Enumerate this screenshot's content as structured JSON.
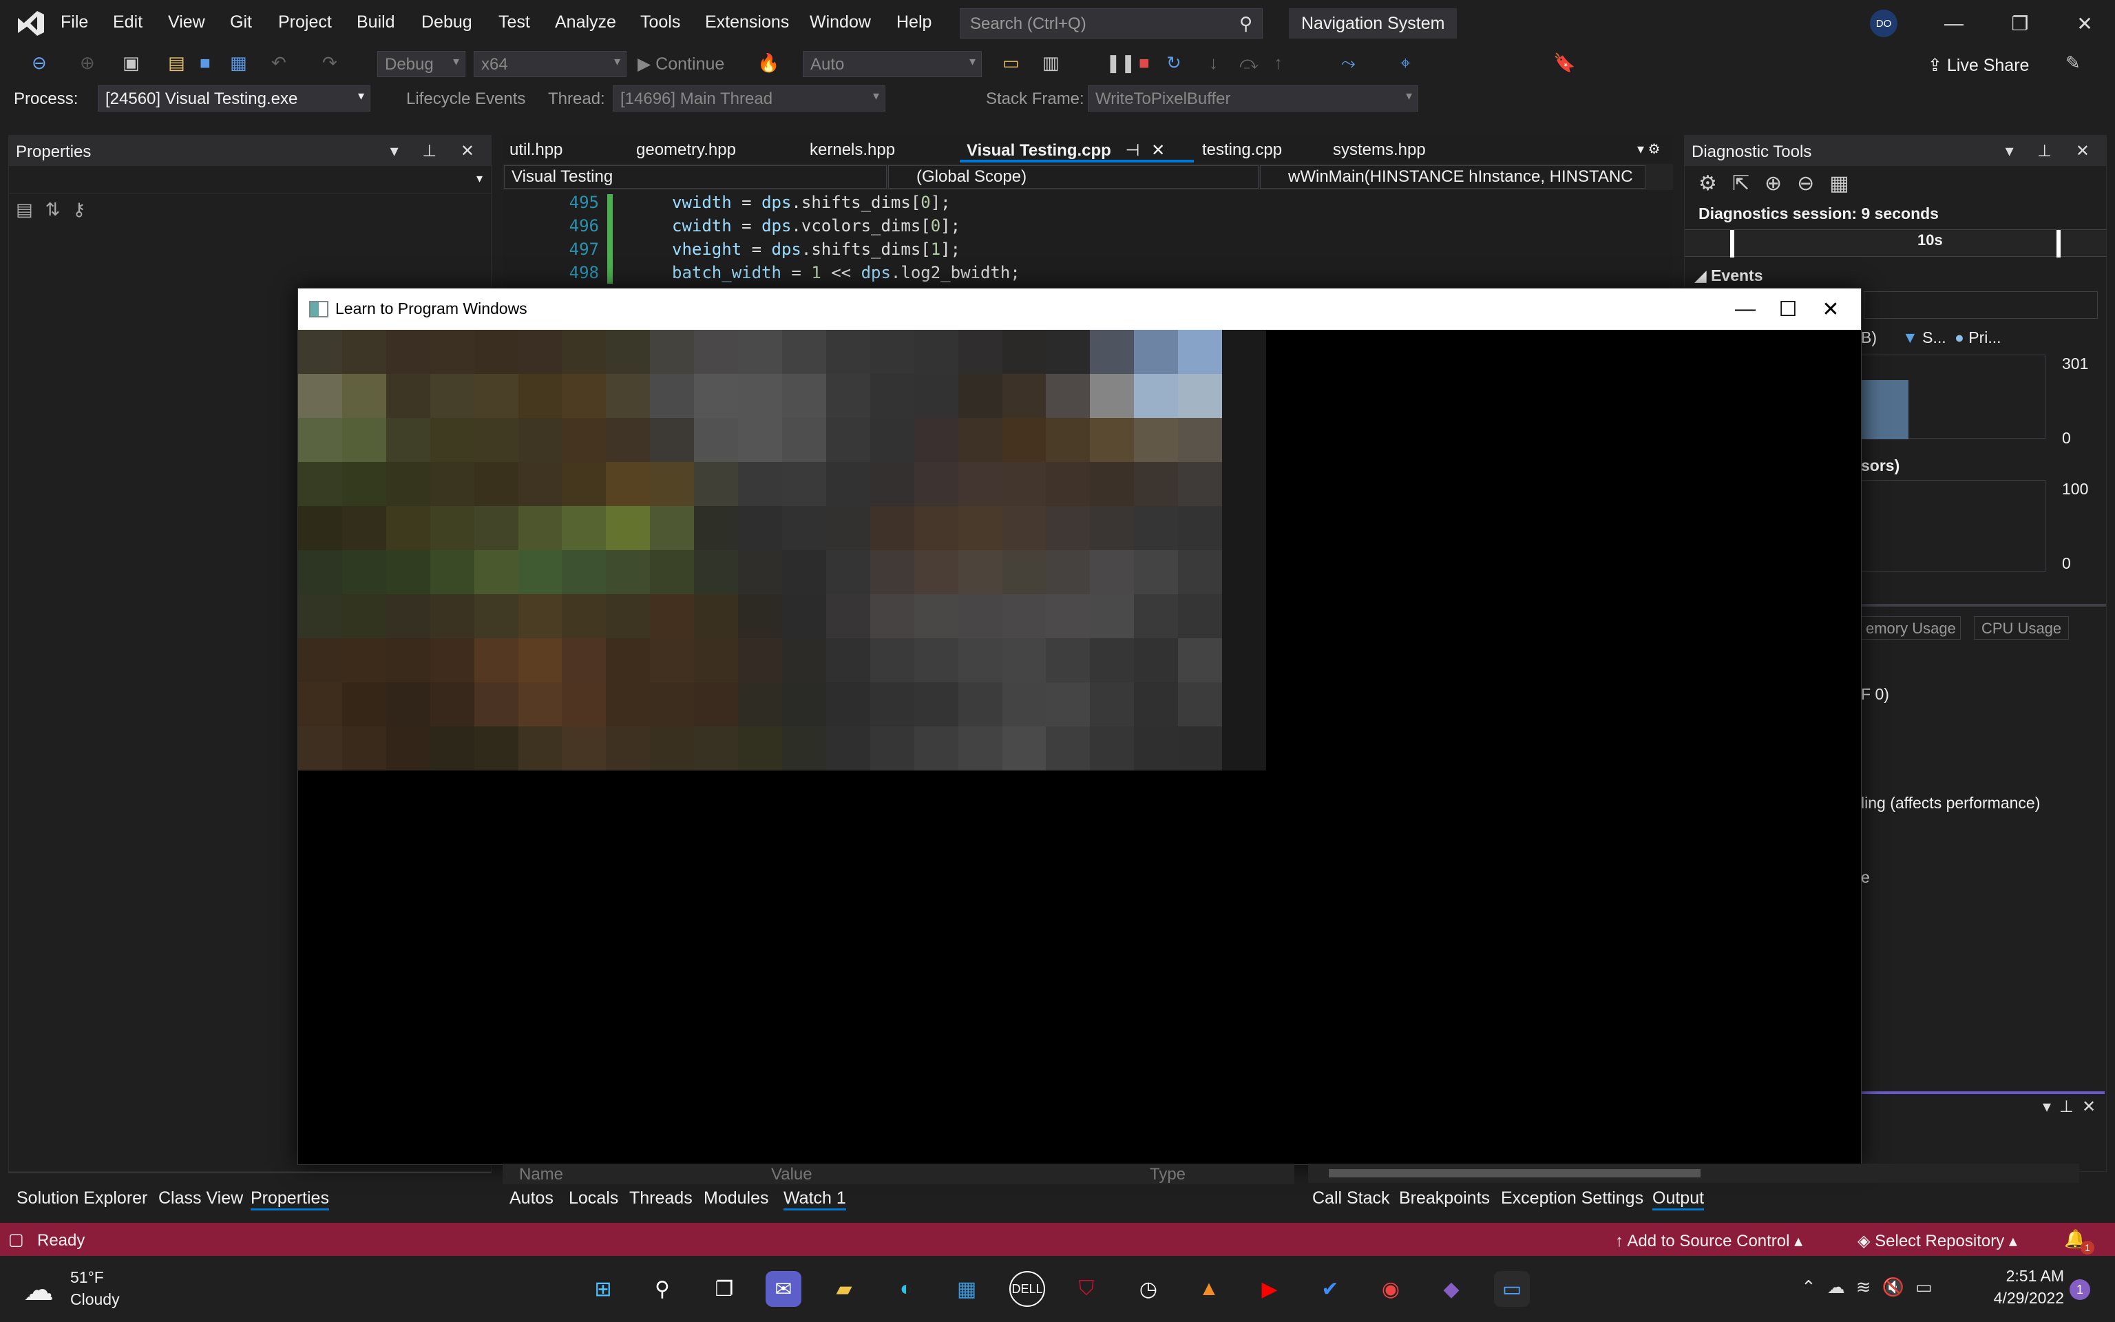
{
  "menu": {
    "items": [
      "File",
      "Edit",
      "View",
      "Git",
      "Project",
      "Build",
      "Debug",
      "Test",
      "Analyze",
      "Tools",
      "Extensions",
      "Window",
      "Help"
    ],
    "search_placeholder": "Search (Ctrl+Q)",
    "solution_name": "Navigation System",
    "avatar_initials": "DO"
  },
  "toolbar": {
    "config": "Debug",
    "platform": "x64",
    "continue_label": "Continue",
    "auto_combo": "Auto",
    "live_share": "Live Share"
  },
  "debugbar": {
    "process_label": "Process:",
    "process_value": "[24560] Visual Testing.exe",
    "lifecycle_label": "Lifecycle Events",
    "thread_label": "Thread:",
    "thread_value": "[14696] Main Thread",
    "stack_label": "Stack Frame:",
    "stack_value": "WriteToPixelBuffer"
  },
  "properties": {
    "title": "Properties"
  },
  "editor": {
    "tabs": [
      "util.hpp",
      "geometry.hpp",
      "kernels.hpp",
      "Visual Testing.cpp",
      "testing.cpp",
      "systems.hpp"
    ],
    "active_tab": "Visual Testing.cpp",
    "project_combo": "Visual Testing",
    "scope_combo": "(Global Scope)",
    "function_combo": "wWinMain(HINSTANCE hInstance, HINSTANC",
    "lines": [
      {
        "num": "495",
        "a": "vwidth",
        "b": " = ",
        "c": "dps",
        "d": ".shifts_dims[",
        "e": "0",
        "f": "];"
      },
      {
        "num": "496",
        "a": "cwidth",
        "b": " = ",
        "c": "dps",
        "d": ".vcolors_dims[",
        "e": "0",
        "f": "];"
      },
      {
        "num": "497",
        "a": "vheight",
        "b": " = ",
        "c": "dps",
        "d": ".shifts_dims[",
        "e": "1",
        "f": "];"
      },
      {
        "num": "498",
        "a": "batch_width",
        "b": " = ",
        "c": "1",
        "d": " << ",
        "e": "dps",
        "f": ".log2_bwidth;"
      }
    ]
  },
  "diagnostics": {
    "title": "Diagnostic Tools",
    "session": "Diagnostics session: 9 seconds",
    "timeline_label": "10s",
    "events_label": "Events",
    "legend_s": "S...",
    "legend_pri": "Pri...",
    "mem_max": "301",
    "mem_min": "0",
    "cpu_max": "100",
    "cpu_min": "0",
    "partial_b": "B)",
    "partial_processors": "sors)",
    "tab_memory": "emory Usage",
    "tab_cpu": "CPU Usage",
    "partial_zero": "F 0)",
    "partial_profiling": "ling (affects performance)",
    "partial_e": "e"
  },
  "app_window": {
    "title": "Learn to Program Windows",
    "pixel_rows": [
      [
        "#3f3a2e",
        "#3d3526",
        "#3a2f22",
        "#3c3023",
        "#3a2e21",
        "#3a2f22",
        "#3d3524",
        "#3a3829",
        "#45433e",
        "#4a4848",
        "#4b4a4a",
        "#424242",
        "#383838",
        "#353535",
        "#333333",
        "#2f2d2d",
        "#2a2928",
        "#2a2a2a",
        "#4e5560",
        "#6d84a4",
        "#87a3c8",
        "#1a1a1a"
      ],
      [
        "#6d6b53",
        "#61613f",
        "#3e3624",
        "#46402a",
        "#4a3f27",
        "#45381f",
        "#4d3b22",
        "#4a4330",
        "#4a4b4a",
        "#565656",
        "#555555",
        "#505050",
        "#3a3a3a",
        "#333333",
        "#323232",
        "#322c25",
        "#3d3228",
        "#4f4948",
        "#858585",
        "#9ab0c8",
        "#a3b5c5",
        "#1a1a1a"
      ],
      [
        "#5a6440",
        "#566038",
        "#404028",
        "#3e3b20",
        "#403a23",
        "#3e3522",
        "#443420",
        "#3f3425",
        "#3d3a36",
        "#525252",
        "#555555",
        "#4e4e4e",
        "#383838",
        "#323232",
        "#3a3030",
        "#3e3125",
        "#45321f",
        "#4a3c26",
        "#5a4a32",
        "#625848",
        "#5a544a",
        "#1a1a1a"
      ],
      [
        "#363d22",
        "#343a1d",
        "#35341c",
        "#3a351e",
        "#3a311c",
        "#3f3321",
        "#45361e",
        "#574221",
        "#524425",
        "#404036",
        "#393939",
        "#3a3a3a",
        "#323232",
        "#343030",
        "#3d3431",
        "#433630",
        "#43362c",
        "#3f332a",
        "#3b3128",
        "#3d3630",
        "#3e3b38",
        "#1a1a1a"
      ],
      [
        "#2e2c18",
        "#332d1b",
        "#3d3a1e",
        "#404022",
        "#434529",
        "#4e562e",
        "#566431",
        "#64742e",
        "#4e5832",
        "#2e3027",
        "#2e2e2e",
        "#313131",
        "#333030",
        "#3e3229",
        "#47362a",
        "#4a3a2c",
        "#463a30",
        "#403834",
        "#393634",
        "#353535",
        "#333333",
        "#1a1a1a"
      ],
      [
        "#2d3622",
        "#2e3b22",
        "#303d20",
        "#3b4a26",
        "#4a5a2e",
        "#405a32",
        "#3c5231",
        "#3f4c2d",
        "#3a4228",
        "#313428",
        "#2f2e2a",
        "#2c2c2c",
        "#353434",
        "#413a36",
        "#4a3e36",
        "#4d443c",
        "#464139",
        "#45423f",
        "#4a4848",
        "#444444",
        "#3a3a3a",
        "#1a1a1a"
      ],
      [
        "#323523",
        "#33341f",
        "#353022",
        "#3b3322",
        "#403923",
        "#4a3d24",
        "#423721",
        "#3e3422",
        "#43301f",
        "#3a3020",
        "#2c2a22",
        "#2b2b2b",
        "#373535",
        "#474343",
        "#4a4747",
        "#484646",
        "#4a4848",
        "#4c4a4a",
        "#4a4a4a",
        "#3a3a3a",
        "#353535",
        "#1a1a1a"
      ],
      [
        "#3a2b1c",
        "#3c2a1a",
        "#3a2a1c",
        "#3f2c1c",
        "#553821",
        "#5e3e22",
        "#4e3422",
        "#3e2c1d",
        "#41301f",
        "#3c2f20",
        "#342c24",
        "#2d2b27",
        "#313030",
        "#3a3a3a",
        "#3e3e3e",
        "#434343",
        "#454545",
        "#3e3e3e",
        "#363636",
        "#323232",
        "#444444",
        "#1a1a1a"
      ],
      [
        "#3e2c1c",
        "#352617",
        "#312418",
        "#37281b",
        "#4a3322",
        "#563a24",
        "#4f3422",
        "#3e2c1c",
        "#3c2d1e",
        "#3a2b1e",
        "#2f2c24",
        "#2a2b26",
        "#2d2d2d",
        "#323232",
        "#343434",
        "#3c3c3c",
        "#444444",
        "#454545",
        "#393939",
        "#303030",
        "#3c3c3c",
        "#1a1a1a"
      ],
      [
        "#3f2f21",
        "#3a2a1b",
        "#332618",
        "#2d2719",
        "#2f2a1a",
        "#3e3320",
        "#473624",
        "#3e3122",
        "#3a3020",
        "#373222",
        "#32311f",
        "#2d2f26",
        "#2f2f2f",
        "#363636",
        "#3d3d3d",
        "#434343",
        "#4a4a4a",
        "#3e3e3e",
        "#363636",
        "#2f2f2f",
        "#2e2e2e",
        "#1a1a1a"
      ]
    ]
  },
  "bottom": {
    "left_tabs": [
      "Solution Explorer",
      "Class View",
      "Properties"
    ],
    "watch_header": [
      "Name",
      "Value",
      "Type"
    ],
    "mid_tabs": [
      "Autos",
      "Locals",
      "Threads",
      "Modules",
      "Watch 1"
    ],
    "right_tabs": [
      "Call Stack",
      "Breakpoints",
      "Exception Settings",
      "Output"
    ]
  },
  "status": {
    "ready": "Ready",
    "source_control": "Add to Source Control",
    "repository": "Select Repository",
    "notification_count": "1"
  },
  "taskbar": {
    "weather_temp": "51°F",
    "weather_desc": "Cloudy",
    "time": "2:51 AM",
    "date": "4/29/2022",
    "notification_badge": "1"
  },
  "colors": {
    "accent": "#0078d4",
    "status_bar": "#8b1d3a",
    "vs_purple": "#865fc5"
  }
}
